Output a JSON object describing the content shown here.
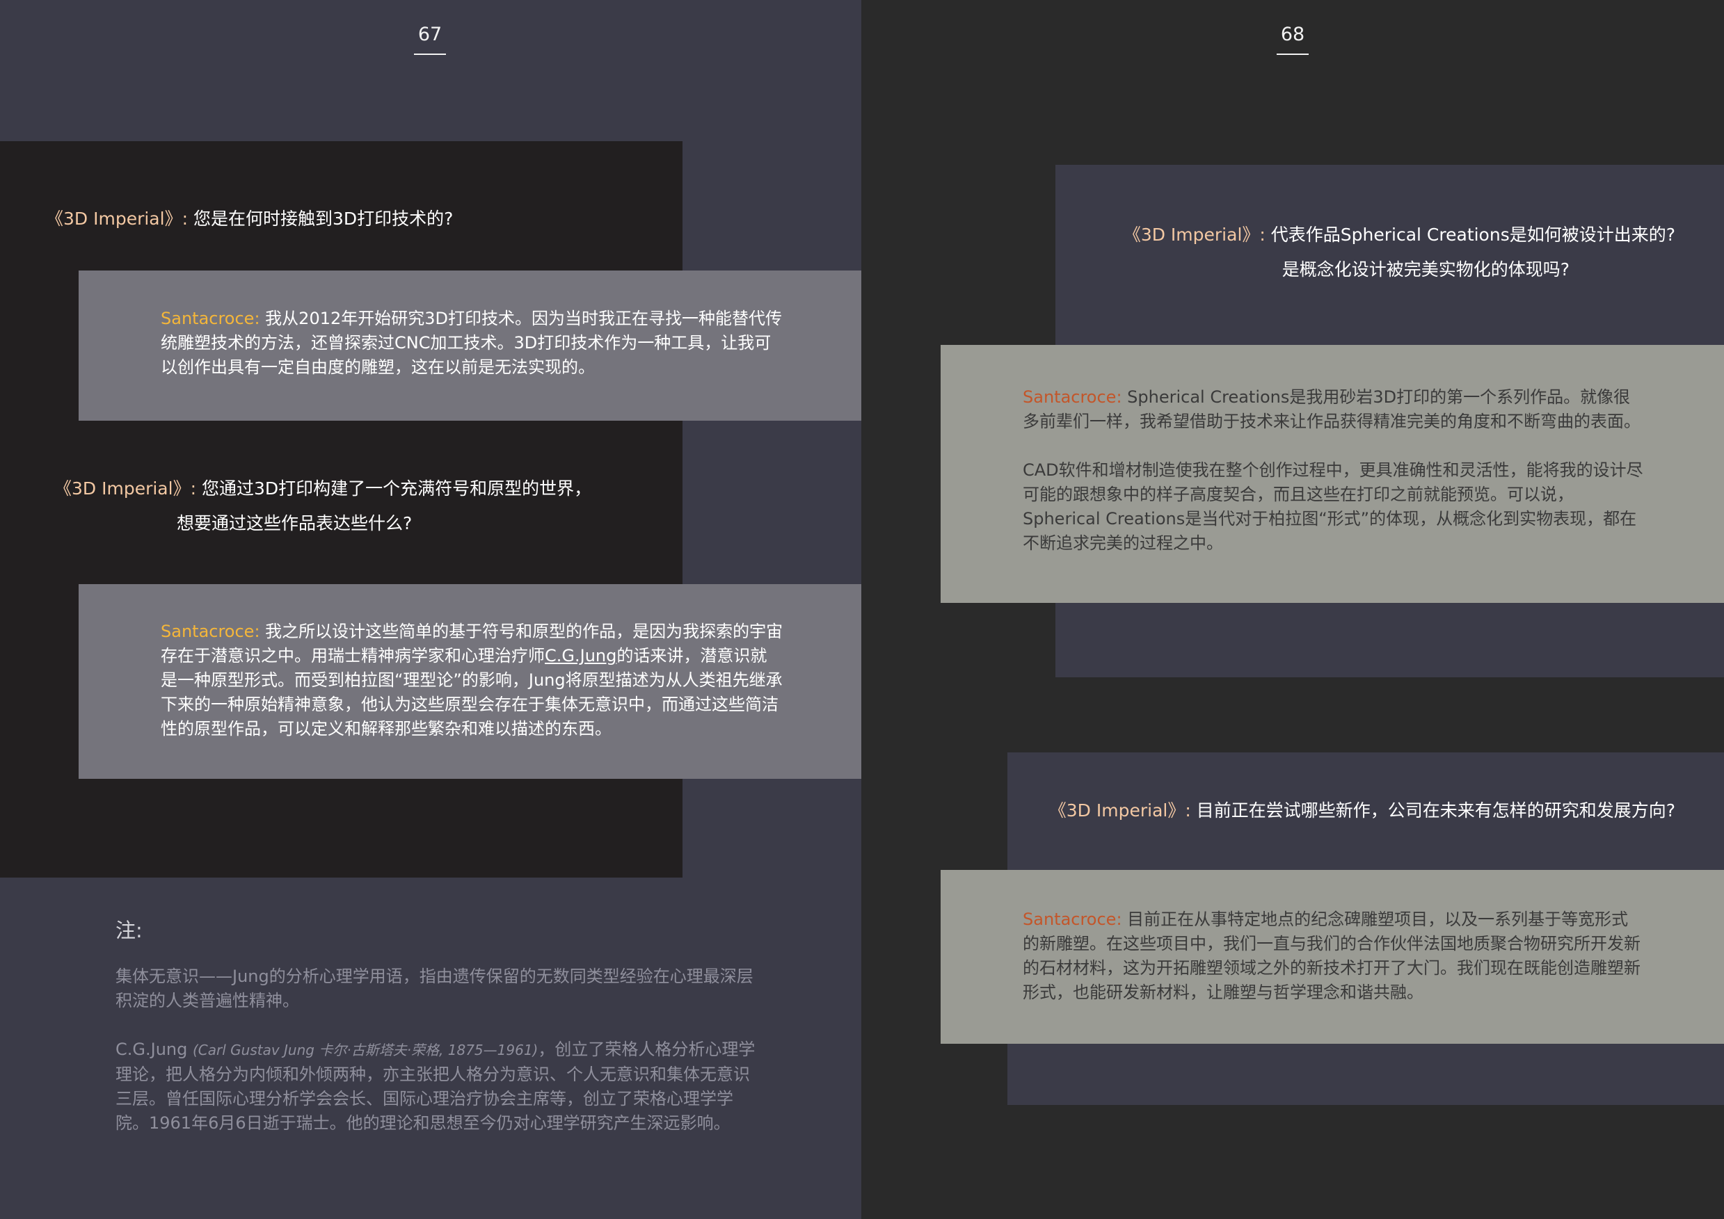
{
  "left_page": {
    "page_number": "67",
    "q1": {
      "tag": "《3D Imperial》",
      "sep": ": ",
      "text": "您是在何时接触到3D打印技术的?"
    },
    "a1": {
      "speaker": "Santacroce: ",
      "text": "我从2012年开始研究3D打印技术。因为当时我正在寻找一种能替代传统雕塑技术的方法，还曾探索过CNC加工技术。3D打印技术作为一种工具，让我可以创作出具有一定自由度的雕塑，这在以前是无法实现的。"
    },
    "q2": {
      "tag": "《3D Imperial》",
      "sep": ": ",
      "line1": "您通过3D打印构建了一个充满符号和原型的世界，",
      "line2": "想要通过这些作品表达些什么?"
    },
    "a2": {
      "speaker": "Santacroce: ",
      "part1": "我之所以设计这些简单的基于符号和原型的作品，是因为我探索的宇宙存在于潜意识之中。用瑞士精神病学家和心理治疗师",
      "link": "C.G.Jung",
      "part2": "的话来讲，潜意识就是一种原型形式。而受到柏拉图“理型论”的影响，Jung将原型描述为从人类祖先继承下来的一种原始精神意象，他认为这些原型会存在于集体无意识中，而通过这些简洁性的原型作品，可以定义和解释那些繁杂和难以描述的东西。"
    },
    "note": {
      "title": "注:",
      "p1": "集体无意识——Jung的分析心理学用语，指由遗传保留的无数同类型经验在心理最深层积淀的人类普遍性精神。",
      "p2_lead": "C.G.Jung ",
      "p2_italic": "(Carl  Gustav  Jung  卡尔·古斯塔夫·荣格, 1875—1961)",
      "p2_rest": "，创立了荣格人格分析心理学理论，把人格分为内倾和外倾两种，亦主张把人格分为意识、个人无意识和集体无意识三层。曾任国际心理分析学会会长、国际心理治疗协会主席等，创立了荣格心理学学院。1961年6月6日逝于瑞士。他的理论和思想至今仍对心理学研究产生深远影响。"
    }
  },
  "right_page": {
    "page_number": "68",
    "q3": {
      "tag": "《3D Imperial》",
      "sep": ": ",
      "line1": "代表作品Spherical Creations是如何被设计出来的?",
      "line2": "是概念化设计被完美实物化的体现吗?"
    },
    "a3": {
      "speaker": "Santacroce: ",
      "p1": "Spherical  Creations是我用砂岩3D打印的第一个系列作品。就像很多前辈们一样，我希望借助于技术来让作品获得精准完美的角度和不断弯曲的表面。",
      "p2": "CAD软件和增材制造使我在整个创作过程中，更具准确性和灵活性，能将我的设计尽可能的跟想象中的样子高度契合，而且这些在打印之前就能预览。可以说，Spherical   Creations是当代对于柏拉图“形式”的体现，从概念化到实物表现，都在不断追求完美的过程之中。"
    },
    "q4": {
      "tag": "《3D Imperial》",
      "sep": ": ",
      "text": "目前正在尝试哪些新作，公司在未来有怎样的研究和发展方向?"
    },
    "a4": {
      "speaker": "Santacroce: ",
      "text": "目前正在从事特定地点的纪念碑雕塑项目，以及一系列基于等宽形式的新雕塑。在这些项目中，我们一直与我们的合作伙伴法国地质聚合物研究所开发新的石材材料，这为开拓雕塑领域之外的新技术打开了大门。我们现在既能创造雕塑新形式，也能研发新材料，让雕塑与哲学理念和谐共融。"
    }
  },
  "colors": {
    "left_bg": "#3b3b48",
    "left_dark_panel": "#221f20",
    "left_answer_box": "#75747c",
    "right_bg": "#2a2a2a",
    "right_slate_panel": "#3b3b48",
    "right_answer_box": "#9a9b94",
    "tag": "#f3c8a3",
    "speaker_left": "#f4b63a",
    "speaker_right": "#c3562a"
  }
}
